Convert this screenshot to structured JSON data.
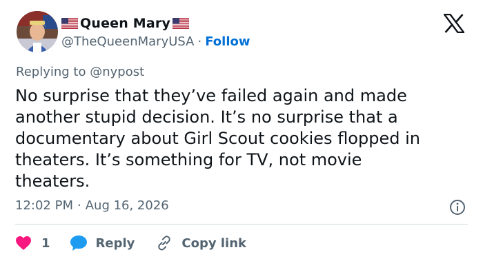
{
  "author": {
    "display_name": "Queen Mary",
    "handle": "@TheQueenMaryUSA",
    "separator": "·",
    "follow_label": "Follow",
    "flag_icon": "us-flag-icon"
  },
  "reply_context": {
    "prefix": "Replying to",
    "mention": "@nypost"
  },
  "tweet": {
    "text": "No surprise that they’ve failed again and made\nanother stupid decision. It’s no surprise that a\ndocumentary about Girl Scout cookies flopped in\ntheaters. It’s something for TV, not movie\ntheaters.",
    "time": "12:02 PM",
    "separator": "·",
    "date": "Aug 16, 2026"
  },
  "actions": {
    "like_count": "1",
    "reply_label": "Reply",
    "copy_link_label": "Copy link"
  },
  "colors": {
    "like_red": "#f91880",
    "reply_blue": "#1d9bf0",
    "follow_blue": "#006fd6",
    "muted_text": "#536471"
  }
}
